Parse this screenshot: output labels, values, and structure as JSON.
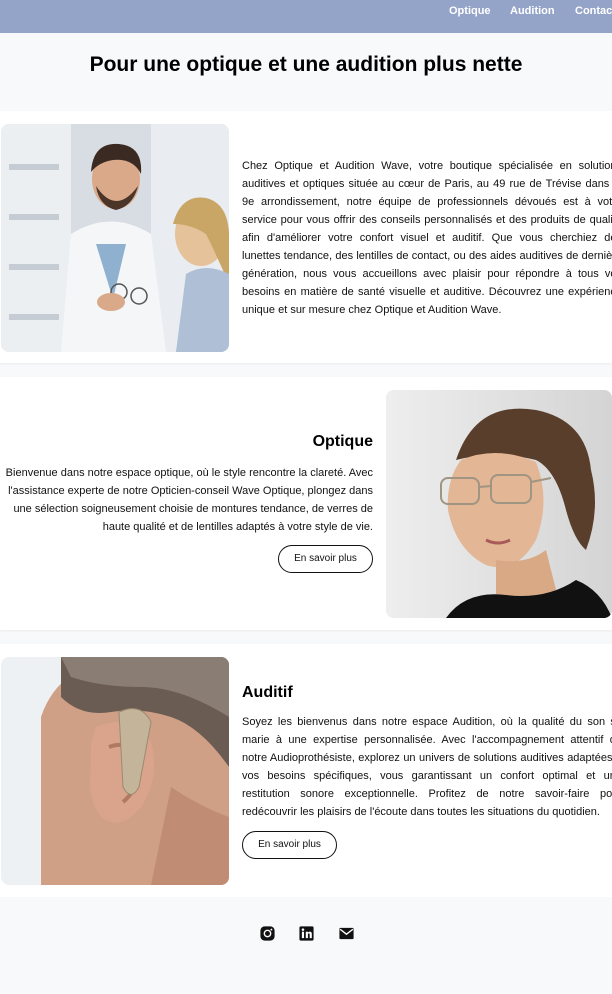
{
  "nav": {
    "items": [
      {
        "label": "Optique"
      },
      {
        "label": "Audition"
      },
      {
        "label": "Contact"
      }
    ]
  },
  "hero": {
    "title": "Pour une optique et une audition plus nette"
  },
  "intro": {
    "text": "Chez Optique et Audition Wave, votre boutique spécialisée en solutions auditives et optiques située au cœur de Paris, au 49 rue de Trévise dans le 9e arrondissement, notre équipe de professionnels dévoués est à votre service pour vous offrir des conseils personnalisés et des produits de qualité afin d'améliorer votre confort visuel et auditif. Que vous cherchiez des lunettes tendance, des lentilles de contact, ou des aides auditives de dernière génération, nous vous accueillons avec plaisir pour répondre à tous vos besoins en matière de santé visuelle et auditive. Découvrez une expérience unique et sur mesure chez Optique et Audition Wave."
  },
  "optique": {
    "title": "Optique",
    "text": "Bienvenue dans notre espace optique, où le style rencontre la clareté. Avec l'assistance experte de notre Opticien-conseil Wave Optique, plongez dans une sélection soigneusement choisie de montures tendance, de verres de haute qualité et de lentilles adaptés à votre style de vie.",
    "button": "En savoir plus"
  },
  "auditif": {
    "title": "Auditif",
    "text": "Soyez les bienvenus dans notre espace Audition, où la qualité du son se marie à une expertise personnalisée. Avec l'accompagnement attentif de notre Audioprothésiste, explorez un univers de solutions auditives adaptées à vos besoins spécifiques, vous garantissant un confort optimal et une restitution sonore exceptionnelle. Profitez de notre savoir-faire pour redécouvrir les plaisirs de l'écoute dans toutes les situations du quotidien.",
    "button": "En savoir plus"
  },
  "footer": {
    "icons": [
      "instagram-icon",
      "linkedin-icon",
      "mail-icon"
    ]
  },
  "colors": {
    "nav_bg": "#94a4c8",
    "page_bg": "#f8f9fb",
    "section_bg": "#ffffff",
    "text": "#111111"
  }
}
